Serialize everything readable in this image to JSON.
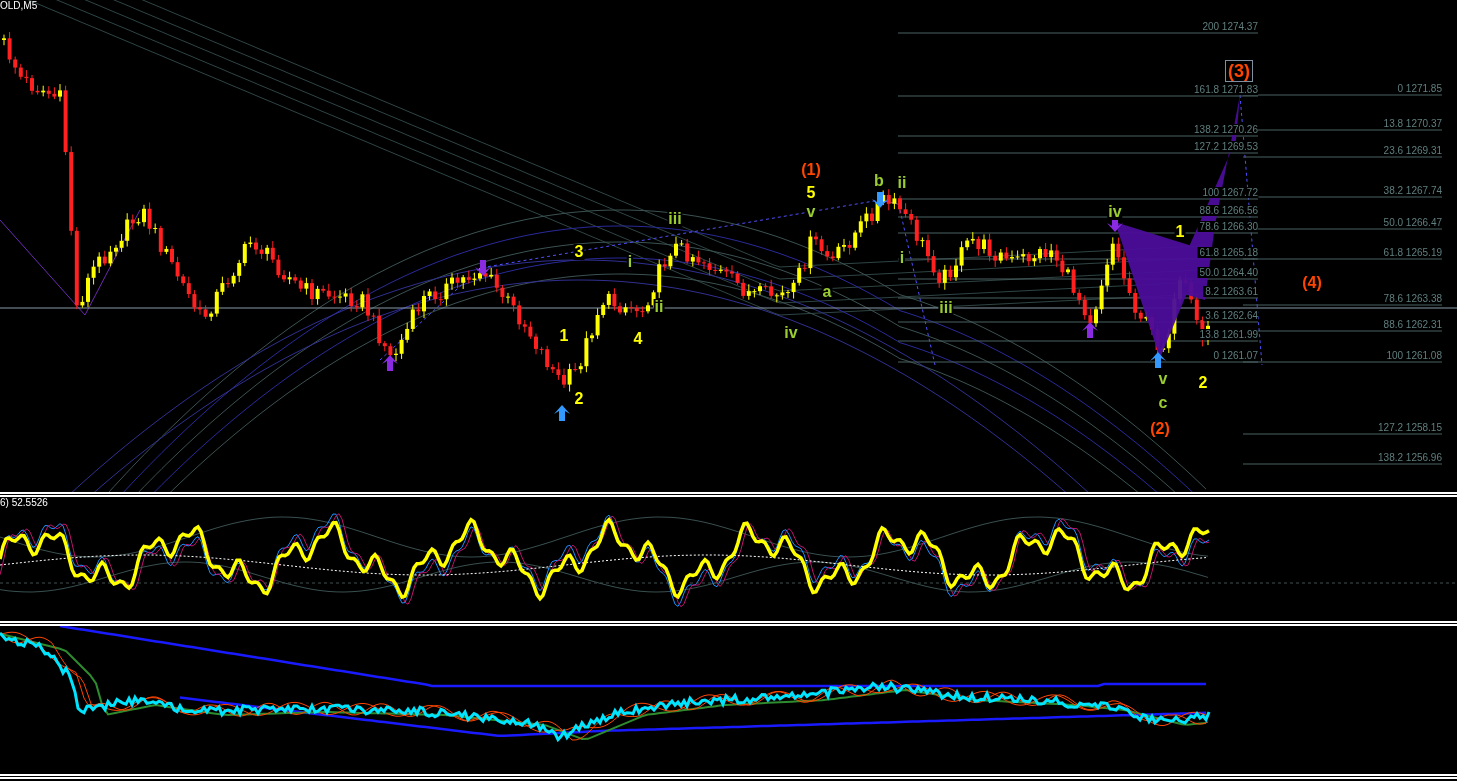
{
  "chart": {
    "symbol_label": "OLD,M5",
    "wave_labels": [
      {
        "text": "(1)",
        "color": "#ff4500",
        "boxed": false
      },
      {
        "text": "5",
        "color": "#ffff00",
        "boxed": false
      },
      {
        "text": "v",
        "color": "#9acd32",
        "boxed": false
      },
      {
        "text": "b",
        "color": "#9acd32",
        "boxed": false
      },
      {
        "text": "ii",
        "color": "#9acd32",
        "boxed": false
      },
      {
        "text": "iii",
        "color": "#9acd32",
        "boxed": false
      },
      {
        "text": "3",
        "color": "#ffff00",
        "boxed": false
      },
      {
        "text": "i",
        "color": "#9acd32",
        "boxed": false
      },
      {
        "text": "ii",
        "color": "#9acd32",
        "boxed": false
      },
      {
        "text": "1",
        "color": "#ffff00",
        "boxed": false
      },
      {
        "text": "4",
        "color": "#ffff00",
        "boxed": false
      },
      {
        "text": "2",
        "color": "#ffff00",
        "boxed": false
      },
      {
        "text": "a",
        "color": "#9acd32",
        "boxed": false
      },
      {
        "text": "iv",
        "color": "#9acd32",
        "boxed": false
      },
      {
        "text": "i",
        "color": "#9acd32",
        "boxed": false
      },
      {
        "text": "iii",
        "color": "#9acd32",
        "boxed": false
      },
      {
        "text": "iv",
        "color": "#9acd32",
        "boxed": false
      },
      {
        "text": "1",
        "color": "#ffff00",
        "boxed": false
      },
      {
        "text": "v",
        "color": "#9acd32",
        "boxed": false
      },
      {
        "text": "2",
        "color": "#ffff00",
        "boxed": false
      },
      {
        "text": "c",
        "color": "#9acd32",
        "boxed": false
      },
      {
        "text": "(2)",
        "color": "#ff4500",
        "boxed": false
      },
      {
        "text": "(4)",
        "color": "#ff4500",
        "boxed": false
      },
      {
        "text": "(3)",
        "color": "#ff4500",
        "boxed": true
      }
    ],
    "fib_levels_left": [
      "200 1274.37",
      "161.8 1271.83",
      "138.2 1270.26",
      "127.2 1269.53",
      "100 1267.72",
      "88.6 1266.56",
      "78.6 1266.30",
      "61.8 1265.18",
      "50.0 1264.40",
      "8.2 1263.61",
      "3.6 1262.64",
      "13.8 1261.99",
      "0 1261.07"
    ],
    "fib_levels_right": [
      "0 1271.85",
      "13.8 1270.37",
      "23.6 1269.31",
      "38.2 1267.74",
      "50.0 1266.47",
      "61.8 1265.19",
      "78.6 1263.38",
      "88.6 1262.31",
      "100 1261.08",
      "127.2 1258.15",
      "138.2 1256.96"
    ]
  },
  "oscillator": {
    "label": "6) 52.5526"
  }
}
